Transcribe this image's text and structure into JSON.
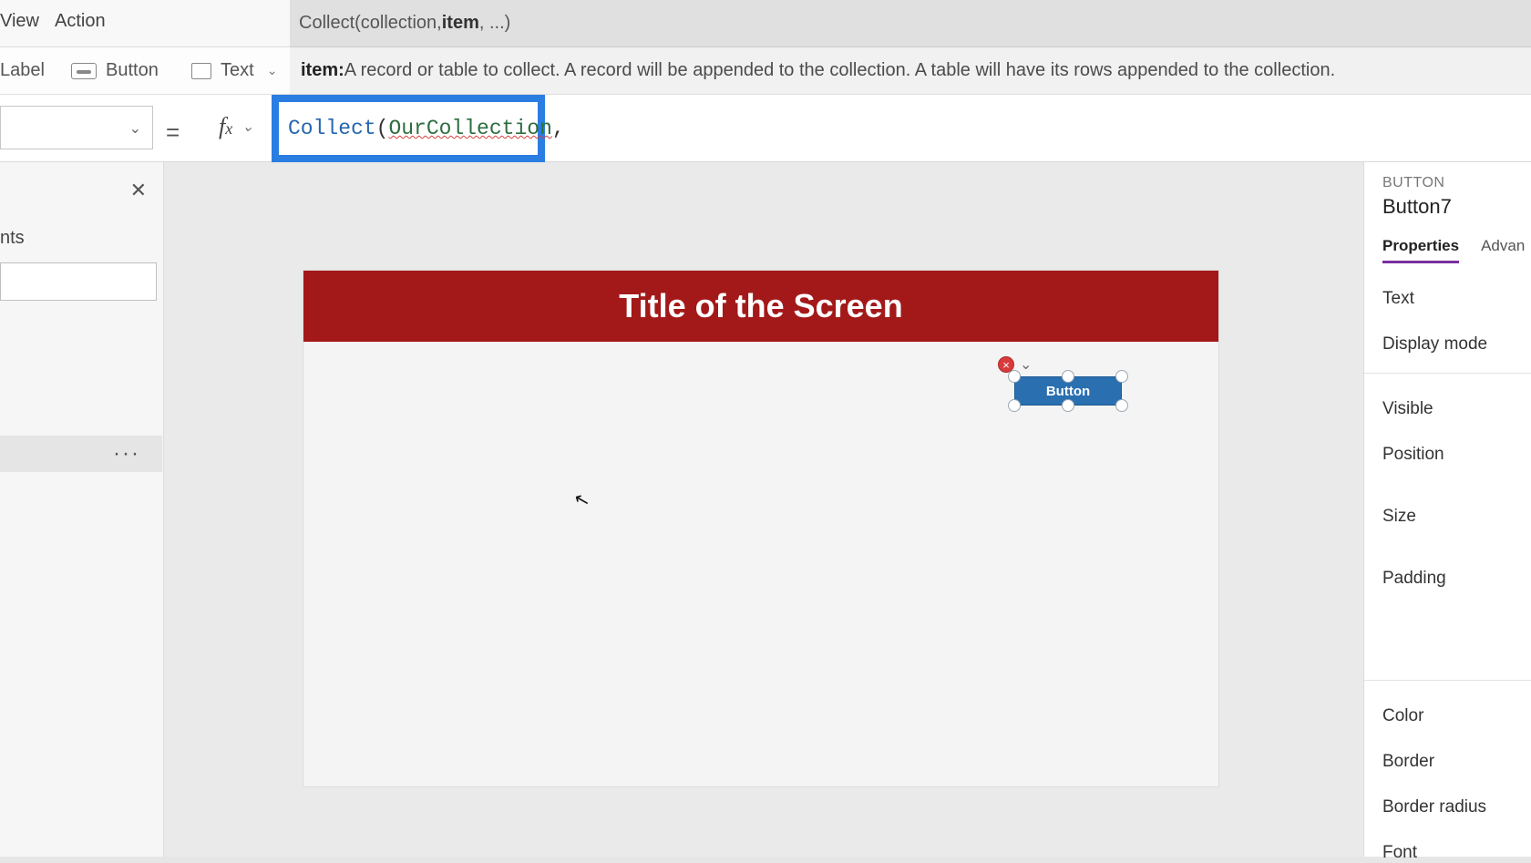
{
  "menu": {
    "view": "View",
    "action": "Action"
  },
  "toolbar": {
    "label": "Label",
    "button": "Button",
    "text": "Text"
  },
  "intellisense": {
    "prefix": "Collect(collection, ",
    "bold": "item",
    "suffix": ", ...)"
  },
  "item_help": {
    "lead": "item: ",
    "desc": "A record or table to collect. A record will be appended to the collection. A table will have its rows appended to the collection."
  },
  "formula": {
    "fn": "Collect",
    "open": "(",
    "arg": "OurCollection",
    "tail": ","
  },
  "tree": {
    "header": "nts",
    "selected_dots": "···"
  },
  "canvas": {
    "title": "Title of the Screen",
    "button_text": "Button",
    "error_glyph": "×",
    "error_chev": "⌄"
  },
  "properties": {
    "kind": "BUTTON",
    "name": "Button7",
    "tabs": {
      "properties": "Properties",
      "advanced": "Advan"
    },
    "rows": {
      "text": "Text",
      "display_mode": "Display mode",
      "visible": "Visible",
      "position": "Position",
      "size": "Size",
      "padding": "Padding",
      "color": "Color",
      "border": "Border",
      "border_radius": "Border radius",
      "font": "Font"
    }
  }
}
